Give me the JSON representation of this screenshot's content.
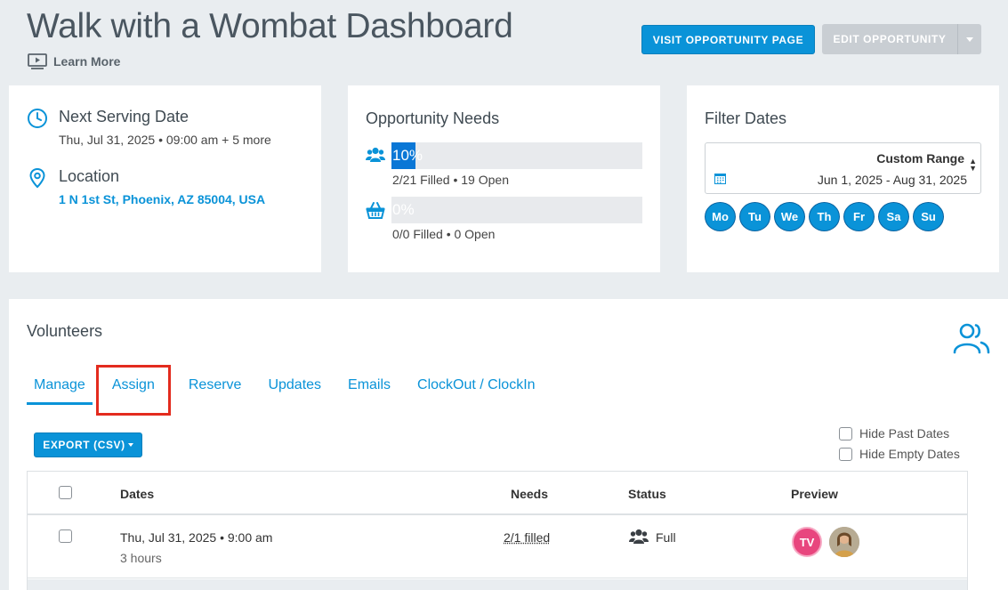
{
  "header": {
    "title": "Walk with a Wombat Dashboard",
    "learn_more": "Learn More",
    "visit_button": "VISIT OPPORTUNITY PAGE",
    "edit_button": "EDIT OPPORTUNITY"
  },
  "serving": {
    "next_label": "Next Serving Date",
    "next_value": "Thu, Jul 31, 2025 • 09:00 am + 5 more",
    "location_label": "Location",
    "location_value": "1 N 1st St, Phoenix, AZ 85004, USA"
  },
  "needs": {
    "title": "Opportunity Needs",
    "items": [
      {
        "icon": "users-icon",
        "percent_label": "10%",
        "filled_fraction": 0.095,
        "caption": "2/21 Filled • 19 Open"
      },
      {
        "icon": "basket-icon",
        "percent_label": "0%",
        "filled_fraction": 0,
        "caption": "0/0 Filled • 0 Open"
      }
    ]
  },
  "filter": {
    "title": "Filter Dates",
    "range_label": "Custom Range",
    "range_value": "Jun 1, 2025 - Aug 31, 2025",
    "days": [
      "Mo",
      "Tu",
      "We",
      "Th",
      "Fr",
      "Sa",
      "Su"
    ]
  },
  "volunteers": {
    "title": "Volunteers",
    "tabs": [
      "Manage",
      "Assign",
      "Reserve",
      "Updates",
      "Emails",
      "ClockOut / ClockIn"
    ],
    "export_label": "EXPORT (CSV)",
    "hide_past": "Hide Past Dates",
    "hide_empty": "Hide Empty Dates",
    "columns": {
      "dates": "Dates",
      "needs": "Needs",
      "status": "Status",
      "preview": "Preview"
    },
    "rows": [
      {
        "date": "Thu, Jul 31, 2025 • 9:00 am",
        "duration": "3 hours",
        "needs": "2/1 filled",
        "status": "Full",
        "avatar_initials": "TV"
      }
    ]
  },
  "colors": {
    "accent": "#0a93d8",
    "highlight": "#e32b1e",
    "avatar_pink": "#e8467e"
  }
}
